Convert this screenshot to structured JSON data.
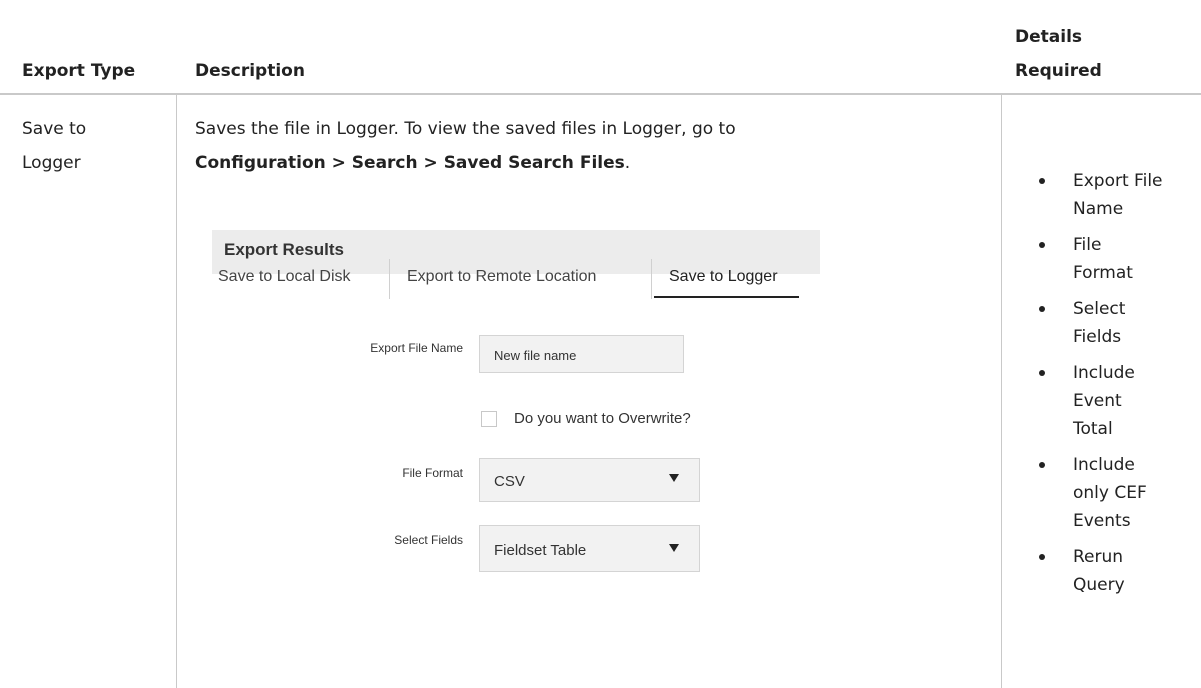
{
  "table": {
    "headers": {
      "export_type": "Export Type",
      "description": "Description",
      "details_line1": "Details",
      "details_line2": "Required"
    },
    "row": {
      "export_type_line1": "Save to",
      "export_type_line2": "Logger",
      "description_line1": "Saves the file in Logger. To view the saved files in Logger, go to",
      "description_path": "Configuration > Search > Saved Search Files",
      "description_period": ".",
      "details": [
        {
          "lines": [
            "Export File",
            "Name"
          ]
        },
        {
          "lines": [
            "File",
            "Format"
          ]
        },
        {
          "lines": [
            "Select",
            "Fields"
          ]
        },
        {
          "lines": [
            "Include",
            "Event",
            "Total"
          ]
        },
        {
          "lines": [
            "Include",
            "only CEF",
            "Events"
          ]
        },
        {
          "lines": [
            "Rerun",
            "Query"
          ]
        }
      ]
    }
  },
  "dialog": {
    "title": "Export Results",
    "tabs": [
      "Save to Local Disk",
      "Export to Remote Location",
      "Save to Logger"
    ],
    "active_tab": "Save to Logger",
    "export_file_name_label": "Export File Name",
    "export_file_name_value": "New file name",
    "overwrite_label": "Do you want to Overwrite?",
    "overwrite_checked": false,
    "file_format_label": "File Format",
    "file_format_value": "CSV",
    "select_fields_label": "Select Fields",
    "select_fields_value": "Fieldset Table"
  },
  "colors": {
    "header_rule": "#c9c9c9",
    "dialog_header_bg": "#ececec",
    "input_bg": "#f2f2f2"
  }
}
